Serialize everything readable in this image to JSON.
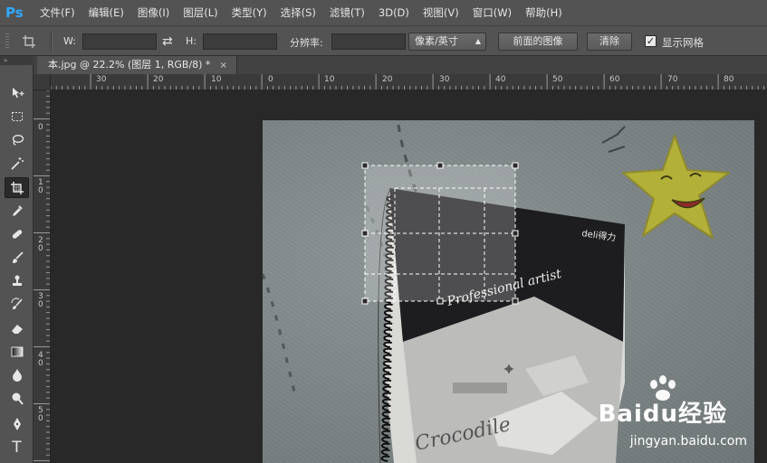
{
  "app": {
    "logo": "Ps"
  },
  "menu": [
    "文件(F)",
    "编辑(E)",
    "图像(I)",
    "图层(L)",
    "类型(Y)",
    "选择(S)",
    "滤镜(T)",
    "3D(D)",
    "视图(V)",
    "窗口(W)",
    "帮助(H)"
  ],
  "options": {
    "width_label": "W:",
    "width_value": "",
    "height_label": "H:",
    "height_value": "",
    "resolution_label": "分辨率:",
    "resolution_value": "",
    "unit_select": "像素/英寸",
    "front_image_button": "前面的图像",
    "clear_button": "清除",
    "show_grid_label": "显示网格",
    "show_grid_checked": true
  },
  "document_tab": {
    "title": "本.jpg @ 22.2% (图层 1, RGB/8) *",
    "close": "×"
  },
  "ruler": {
    "horizontal_labels": [
      "30",
      "20",
      "10",
      "0",
      "10",
      "20",
      "30",
      "40",
      "50",
      "60",
      "70",
      "80"
    ],
    "vertical_labels": [
      "0",
      "10",
      "20",
      "30",
      "40",
      "50"
    ]
  },
  "tools": [
    "move-tool",
    "marquee-tool",
    "lasso-tool",
    "magic-wand-tool",
    "crop-tool",
    "eyedropper-tool",
    "healing-brush-tool",
    "brush-tool",
    "clone-stamp-tool",
    "history-brush-tool",
    "eraser-tool",
    "gradient-tool",
    "blur-tool",
    "dodge-tool",
    "pen-tool",
    "type-tool"
  ],
  "canvas_text": {
    "notebook_brand": "deli得力",
    "notebook_script": "Professional artist",
    "notebook_bottom_script": "Crocodile",
    "watermark_logo": "Baidu经验",
    "watermark_url": "jingyan.baidu.com"
  },
  "colors": {
    "ps_blue": "#31a8ff",
    "panel": "#535353",
    "workspace": "#282828"
  }
}
